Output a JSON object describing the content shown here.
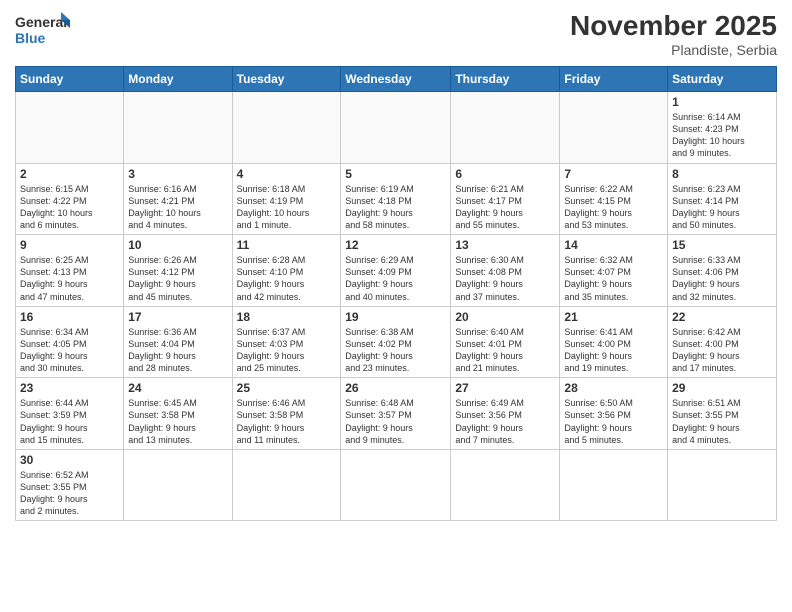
{
  "header": {
    "logo_general": "General",
    "logo_blue": "Blue",
    "month_title": "November 2025",
    "subtitle": "Plandiste, Serbia"
  },
  "days_of_week": [
    "Sunday",
    "Monday",
    "Tuesday",
    "Wednesday",
    "Thursday",
    "Friday",
    "Saturday"
  ],
  "weeks": [
    [
      {
        "day": "",
        "info": ""
      },
      {
        "day": "",
        "info": ""
      },
      {
        "day": "",
        "info": ""
      },
      {
        "day": "",
        "info": ""
      },
      {
        "day": "",
        "info": ""
      },
      {
        "day": "",
        "info": ""
      },
      {
        "day": "1",
        "info": "Sunrise: 6:14 AM\nSunset: 4:23 PM\nDaylight: 10 hours\nand 9 minutes."
      }
    ],
    [
      {
        "day": "2",
        "info": "Sunrise: 6:15 AM\nSunset: 4:22 PM\nDaylight: 10 hours\nand 6 minutes."
      },
      {
        "day": "3",
        "info": "Sunrise: 6:16 AM\nSunset: 4:21 PM\nDaylight: 10 hours\nand 4 minutes."
      },
      {
        "day": "4",
        "info": "Sunrise: 6:18 AM\nSunset: 4:19 PM\nDaylight: 10 hours\nand 1 minute."
      },
      {
        "day": "5",
        "info": "Sunrise: 6:19 AM\nSunset: 4:18 PM\nDaylight: 9 hours\nand 58 minutes."
      },
      {
        "day": "6",
        "info": "Sunrise: 6:21 AM\nSunset: 4:17 PM\nDaylight: 9 hours\nand 55 minutes."
      },
      {
        "day": "7",
        "info": "Sunrise: 6:22 AM\nSunset: 4:15 PM\nDaylight: 9 hours\nand 53 minutes."
      },
      {
        "day": "8",
        "info": "Sunrise: 6:23 AM\nSunset: 4:14 PM\nDaylight: 9 hours\nand 50 minutes."
      }
    ],
    [
      {
        "day": "9",
        "info": "Sunrise: 6:25 AM\nSunset: 4:13 PM\nDaylight: 9 hours\nand 47 minutes."
      },
      {
        "day": "10",
        "info": "Sunrise: 6:26 AM\nSunset: 4:12 PM\nDaylight: 9 hours\nand 45 minutes."
      },
      {
        "day": "11",
        "info": "Sunrise: 6:28 AM\nSunset: 4:10 PM\nDaylight: 9 hours\nand 42 minutes."
      },
      {
        "day": "12",
        "info": "Sunrise: 6:29 AM\nSunset: 4:09 PM\nDaylight: 9 hours\nand 40 minutes."
      },
      {
        "day": "13",
        "info": "Sunrise: 6:30 AM\nSunset: 4:08 PM\nDaylight: 9 hours\nand 37 minutes."
      },
      {
        "day": "14",
        "info": "Sunrise: 6:32 AM\nSunset: 4:07 PM\nDaylight: 9 hours\nand 35 minutes."
      },
      {
        "day": "15",
        "info": "Sunrise: 6:33 AM\nSunset: 4:06 PM\nDaylight: 9 hours\nand 32 minutes."
      }
    ],
    [
      {
        "day": "16",
        "info": "Sunrise: 6:34 AM\nSunset: 4:05 PM\nDaylight: 9 hours\nand 30 minutes."
      },
      {
        "day": "17",
        "info": "Sunrise: 6:36 AM\nSunset: 4:04 PM\nDaylight: 9 hours\nand 28 minutes."
      },
      {
        "day": "18",
        "info": "Sunrise: 6:37 AM\nSunset: 4:03 PM\nDaylight: 9 hours\nand 25 minutes."
      },
      {
        "day": "19",
        "info": "Sunrise: 6:38 AM\nSunset: 4:02 PM\nDaylight: 9 hours\nand 23 minutes."
      },
      {
        "day": "20",
        "info": "Sunrise: 6:40 AM\nSunset: 4:01 PM\nDaylight: 9 hours\nand 21 minutes."
      },
      {
        "day": "21",
        "info": "Sunrise: 6:41 AM\nSunset: 4:00 PM\nDaylight: 9 hours\nand 19 minutes."
      },
      {
        "day": "22",
        "info": "Sunrise: 6:42 AM\nSunset: 4:00 PM\nDaylight: 9 hours\nand 17 minutes."
      }
    ],
    [
      {
        "day": "23",
        "info": "Sunrise: 6:44 AM\nSunset: 3:59 PM\nDaylight: 9 hours\nand 15 minutes."
      },
      {
        "day": "24",
        "info": "Sunrise: 6:45 AM\nSunset: 3:58 PM\nDaylight: 9 hours\nand 13 minutes."
      },
      {
        "day": "25",
        "info": "Sunrise: 6:46 AM\nSunset: 3:58 PM\nDaylight: 9 hours\nand 11 minutes."
      },
      {
        "day": "26",
        "info": "Sunrise: 6:48 AM\nSunset: 3:57 PM\nDaylight: 9 hours\nand 9 minutes."
      },
      {
        "day": "27",
        "info": "Sunrise: 6:49 AM\nSunset: 3:56 PM\nDaylight: 9 hours\nand 7 minutes."
      },
      {
        "day": "28",
        "info": "Sunrise: 6:50 AM\nSunset: 3:56 PM\nDaylight: 9 hours\nand 5 minutes."
      },
      {
        "day": "29",
        "info": "Sunrise: 6:51 AM\nSunset: 3:55 PM\nDaylight: 9 hours\nand 4 minutes."
      }
    ],
    [
      {
        "day": "30",
        "info": "Sunrise: 6:52 AM\nSunset: 3:55 PM\nDaylight: 9 hours\nand 2 minutes."
      },
      {
        "day": "",
        "info": ""
      },
      {
        "day": "",
        "info": ""
      },
      {
        "day": "",
        "info": ""
      },
      {
        "day": "",
        "info": ""
      },
      {
        "day": "",
        "info": ""
      },
      {
        "day": "",
        "info": ""
      }
    ]
  ]
}
